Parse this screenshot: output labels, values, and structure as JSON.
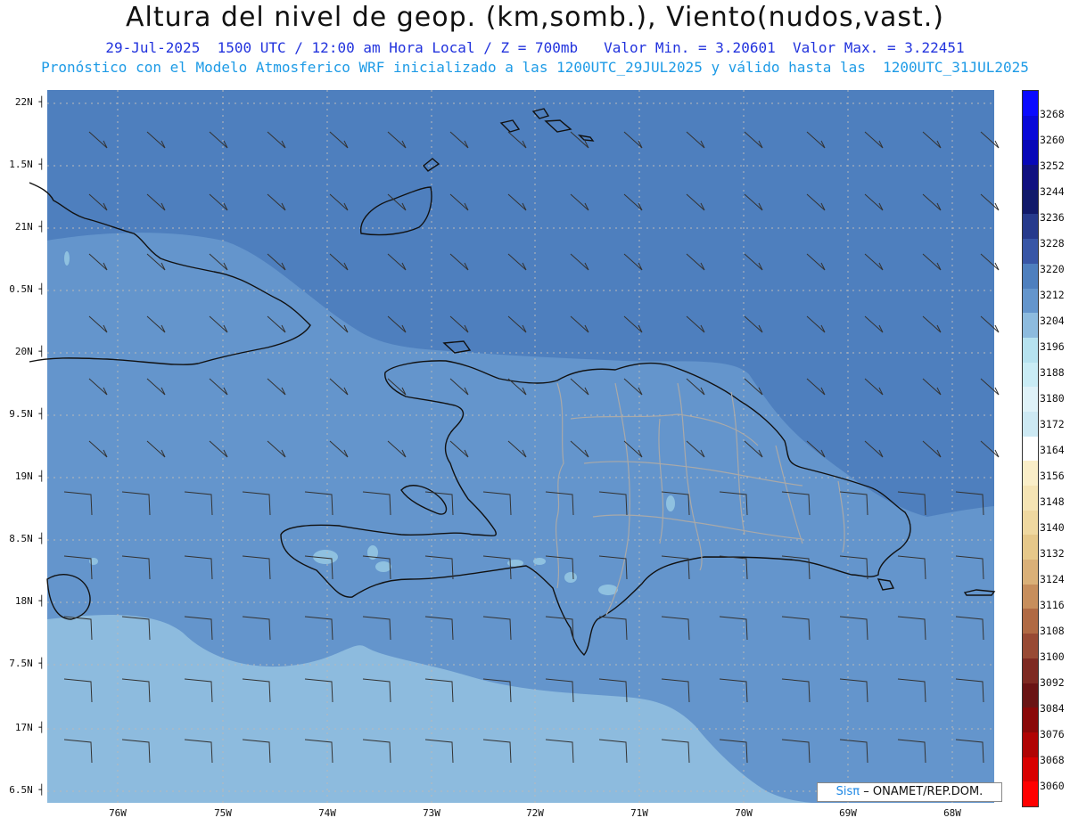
{
  "header": {
    "title": "Altura del nivel de geop. (km,somb.), Viento(nudos,vast.)",
    "line1": "29-Jul-2025  1500 UTC / 12:00 am Hora Local / Z = 700mb   Valor Min. = 3.20601  Valor Max. = 3.22451",
    "line2": "Pronóstico con el Modelo Atmosferico WRF inicializado a las 1200UTC_29JUL2025 y válido hasta las  1200UTC_31JUL2025"
  },
  "map": {
    "lat_labels": [
      "22N",
      "1.5N",
      "21N",
      "0.5N",
      "20N",
      "9.5N",
      "19N",
      "8.5N",
      "18N",
      "7.5N",
      "17N",
      "6.5N"
    ],
    "lon_labels": [
      "76W",
      "75W",
      "74W",
      "73W",
      "72W",
      "71W",
      "70W",
      "69W",
      "68W"
    ],
    "colors": {
      "deep": "#4e7fbe",
      "mid": "#6495cc",
      "light": "#8dbbde",
      "patch": "#8fc1e0",
      "coast": "#111111",
      "borders": "#a9a9a9",
      "grid": "#b9b9b9",
      "barb": "#333333"
    }
  },
  "colorbar": {
    "labels": [
      "3268",
      "3260",
      "3252",
      "3244",
      "3236",
      "3228",
      "3220",
      "3212",
      "3204",
      "3196",
      "3188",
      "3180",
      "3172",
      "3164",
      "3156",
      "3148",
      "3140",
      "3132",
      "3124",
      "3116",
      "3108",
      "3100",
      "3092",
      "3084",
      "3076",
      "3068",
      "3060"
    ],
    "colors": [
      "#0a0aff",
      "#0808d8",
      "#0707b8",
      "#101080",
      "#111a6a",
      "#263a8c",
      "#3856a6",
      "#4e7fbe",
      "#6495cc",
      "#8dbbde",
      "#b6e2ef",
      "#c9ecf5",
      "#dff2f8",
      "#cde9f3",
      "#ffffff",
      "#faeec8",
      "#f5e4b4",
      "#efd8a0",
      "#e6c88a",
      "#dab078",
      "#c78e5c",
      "#b06a44",
      "#984a34",
      "#7e2a22",
      "#6a1414",
      "#8a0808",
      "#b00404",
      "#d80000",
      "#ff0000"
    ]
  },
  "credit": {
    "brand": "Sisπ",
    "text": "– ONAMET/REP.DOM."
  }
}
